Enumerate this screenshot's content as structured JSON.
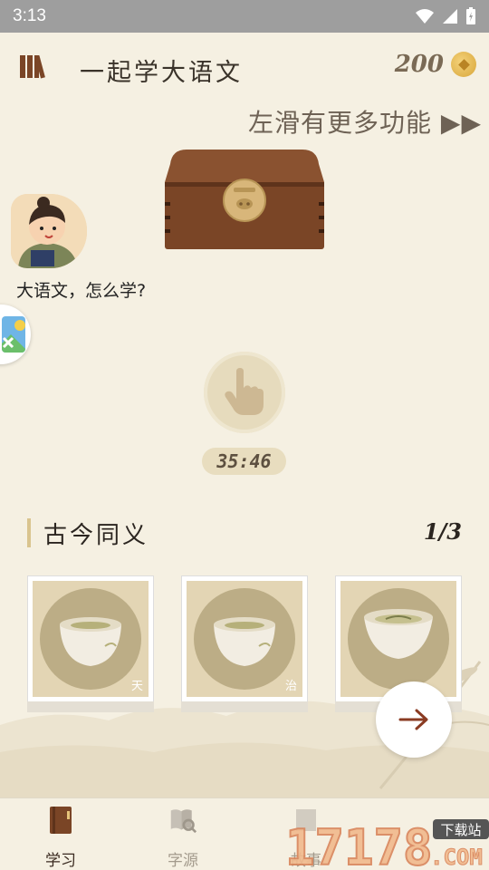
{
  "status_bar": {
    "time": "3:13"
  },
  "header": {
    "title": "一起学大语文",
    "coin_count": "200"
  },
  "swipe_hint": "左滑有更多功能 ▶▶",
  "mascot": {
    "caption": "大语文，怎么学?"
  },
  "timer": "35:46",
  "section": {
    "title": "古今同义",
    "page": "1/3"
  },
  "cards": [
    {
      "char": "天"
    },
    {
      "char": "治"
    },
    {
      "char": ""
    }
  ],
  "bottom_nav": [
    {
      "label": "学习",
      "active": true
    },
    {
      "label": "字源",
      "active": false
    },
    {
      "label": "故事",
      "active": false
    }
  ],
  "watermark": {
    "number": "17178",
    "tag": "下载站",
    "domain": ".COM"
  },
  "colors": {
    "accent": "#d9c48e",
    "background": "#f5f0e2",
    "chest": "#7a4526"
  }
}
